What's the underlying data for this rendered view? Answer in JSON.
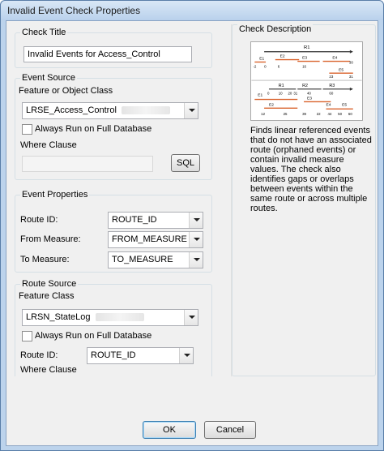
{
  "window": {
    "title": "Invalid Event Check Properties"
  },
  "check_title": {
    "group_label": "Check Title",
    "value": "Invalid Events for Access_Control"
  },
  "event_source": {
    "group_label": "Event Source",
    "feature_label": "Feature or Object Class",
    "feature_value": "LRSE_Access_Control",
    "always_run_label": "Always Run on Full Database",
    "always_run_checked": false,
    "where_label": "Where Clause",
    "where_value": "",
    "sql_button": "SQL"
  },
  "event_properties": {
    "group_label": "Event Properties",
    "route_id_label": "Route ID:",
    "route_id_value": "ROUTE_ID",
    "from_label": "From Measure:",
    "from_value": "FROM_MEASURE",
    "to_label": "To Measure:",
    "to_value": "TO_MEASURE"
  },
  "route_source": {
    "group_label": "Route Source",
    "feature_label": "Feature Class",
    "feature_value": "LRSN_StateLog",
    "always_run_label": "Always Run on Full Database",
    "always_run_checked": false,
    "route_id_label": "Route ID:",
    "route_id_value": "ROUTE_ID",
    "where_label": "Where Clause"
  },
  "check_description": {
    "group_label": "Check Description",
    "text": "Finds linear referenced events that do not have an associated route (orphaned events) or contain invalid measure values. The check also identifies gaps or overlaps between events within the same route or across multiple routes."
  },
  "diagram": {
    "top": {
      "route": "R1",
      "events": [
        "E1",
        "E2",
        "E3",
        "E4",
        "E5"
      ],
      "ticks": [
        "-2",
        "0",
        "6",
        "16",
        "30",
        "23",
        "31"
      ]
    },
    "bottom": {
      "routes": [
        "R1",
        "R2",
        "R3"
      ],
      "events": [
        "E1",
        "E2",
        "E3",
        "E4",
        "E5"
      ],
      "ticks": [
        "0",
        "10",
        "20",
        "31",
        "40",
        "60",
        "12",
        "25",
        "39",
        "22",
        "44",
        "50",
        "60"
      ]
    }
  },
  "buttons": {
    "ok": "OK",
    "cancel": "Cancel"
  },
  "colors": {
    "event_line": "#d9622b",
    "route_line": "#333333",
    "accent": "#3c7fb1"
  }
}
